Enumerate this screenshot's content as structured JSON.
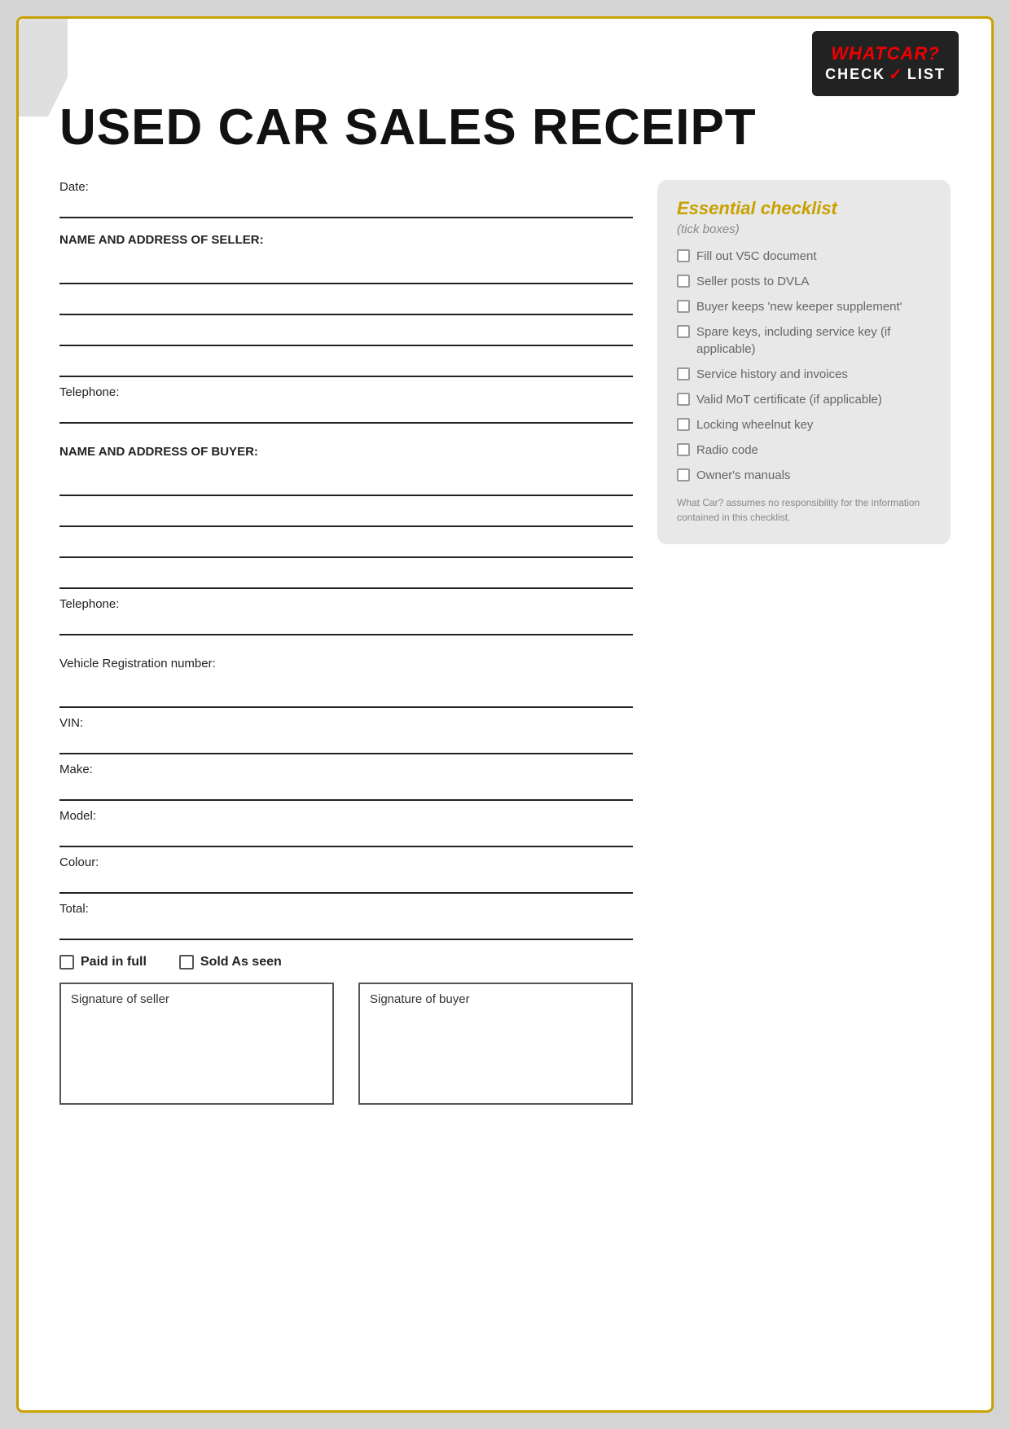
{
  "page": {
    "title": "USED CAR SALES RECEIPT"
  },
  "logo": {
    "whatcar": "WHATCAR?",
    "checklist": "CHECKLIST",
    "check_symbol": "✓"
  },
  "form": {
    "date_label": "Date:",
    "seller_label": "NAME AND ADDRESS OF SELLER:",
    "seller_telephone_label": "Telephone:",
    "buyer_label": "NAME AND ADDRESS OF BUYER:",
    "buyer_telephone_label": "Telephone:",
    "vehicle_reg_label": "Vehicle Registration number:",
    "vin_label": "VIN:",
    "make_label": "Make:",
    "model_label": "Model:",
    "colour_label": "Colour:",
    "total_label": "Total:",
    "paid_full_label": "Paid in full",
    "sold_as_seen_label": "Sold As seen",
    "signature_seller_label": "Signature of seller",
    "signature_buyer_label": "Signature of buyer"
  },
  "checklist": {
    "title": "Essential checklist",
    "subtitle": "(tick boxes)",
    "items": [
      {
        "text": "Fill out V5C document"
      },
      {
        "text": "Seller posts to DVLA"
      },
      {
        "text": "Buyer keeps 'new keeper supplement'"
      },
      {
        "text": "Spare keys, including service key (if applicable)"
      },
      {
        "text": "Service history and invoices"
      },
      {
        "text": "Valid MoT certificate (if applicable)"
      },
      {
        "text": "Locking wheelnut key"
      },
      {
        "text": "Radio code"
      },
      {
        "text": "Owner's manuals"
      }
    ],
    "disclaimer": "What Car? assumes no responsibility for the information contained in this checklist."
  }
}
